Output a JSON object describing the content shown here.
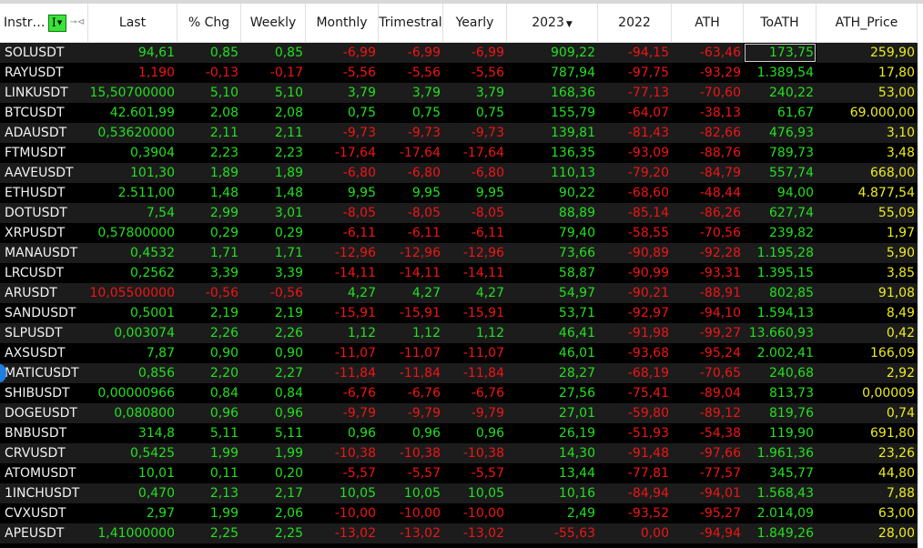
{
  "header": {
    "columns": [
      {
        "label": "Instr…",
        "key": "name"
      },
      {
        "label": "Last",
        "key": "last"
      },
      {
        "label": "% Chg",
        "key": "chg"
      },
      {
        "label": "Weekly",
        "key": "weekly"
      },
      {
        "label": "Monthly",
        "key": "monthly"
      },
      {
        "label": "Trimestral",
        "key": "trimestral"
      },
      {
        "label": "Yearly",
        "key": "yearly"
      },
      {
        "label": "2023",
        "key": "y2023",
        "sort": "descending"
      },
      {
        "label": "2022",
        "key": "y2022"
      },
      {
        "label": "ATH",
        "key": "ath"
      },
      {
        "label": "ToATH",
        "key": "toath"
      },
      {
        "label": "ATH_Price",
        "key": "ath_price"
      }
    ],
    "filter_button_label": "I",
    "filter_icon": "filter-dropdown-icon",
    "pin_icon": "pin-icon",
    "sort_icon": "sort-descending-icon"
  },
  "colors": {
    "positive": "#22e01e",
    "negative": "#f01414",
    "ath_price": "#ecec1e",
    "name": "#f2f2f2",
    "row_odd": "#1c1c1c",
    "row_even": "#000000",
    "filter_button": "#3ae23a"
  },
  "selected_cell": {
    "row": 0,
    "column": "toath"
  },
  "rows": [
    {
      "name": "SOLUSDT",
      "last": "94,61",
      "chg": "0,85",
      "weekly": "0,85",
      "monthly": "-6,99",
      "trimestral": "-6,99",
      "yearly": "-6,99",
      "y2023": "909,22",
      "y2022": "-94,15",
      "ath": "-63,46",
      "toath": "173,75",
      "ath_price": "259,90",
      "last_dir": "pos"
    },
    {
      "name": "RAYUSDT",
      "last": "1,190",
      "chg": "-0,13",
      "weekly": "-0,17",
      "monthly": "-5,56",
      "trimestral": "-5,56",
      "yearly": "-5,56",
      "y2023": "787,94",
      "y2022": "-97,75",
      "ath": "-93,29",
      "toath": "1.389,54",
      "ath_price": "17,80",
      "last_dir": "neg"
    },
    {
      "name": "LINKUSDT",
      "last": "15,50700000",
      "chg": "5,10",
      "weekly": "5,10",
      "monthly": "3,79",
      "trimestral": "3,79",
      "yearly": "3,79",
      "y2023": "168,36",
      "y2022": "-77,13",
      "ath": "-70,60",
      "toath": "240,22",
      "ath_price": "53,00",
      "last_dir": "pos"
    },
    {
      "name": "BTCUSDT",
      "last": "42.601,99",
      "chg": "2,08",
      "weekly": "2,08",
      "monthly": "0,75",
      "trimestral": "0,75",
      "yearly": "0,75",
      "y2023": "155,79",
      "y2022": "-64,07",
      "ath": "-38,13",
      "toath": "61,67",
      "ath_price": "69.000,00",
      "last_dir": "pos"
    },
    {
      "name": "ADAUSDT",
      "last": "0,53620000",
      "chg": "2,11",
      "weekly": "2,11",
      "monthly": "-9,73",
      "trimestral": "-9,73",
      "yearly": "-9,73",
      "y2023": "139,81",
      "y2022": "-81,43",
      "ath": "-82,66",
      "toath": "476,93",
      "ath_price": "3,10",
      "last_dir": "pos"
    },
    {
      "name": "FTMUSDT",
      "last": "0,3904",
      "chg": "2,23",
      "weekly": "2,23",
      "monthly": "-17,64",
      "trimestral": "-17,64",
      "yearly": "-17,64",
      "y2023": "136,35",
      "y2022": "-93,09",
      "ath": "-88,76",
      "toath": "789,73",
      "ath_price": "3,48",
      "last_dir": "pos"
    },
    {
      "name": "AAVEUSDT",
      "last": "101,30",
      "chg": "1,89",
      "weekly": "1,89",
      "monthly": "-6,80",
      "trimestral": "-6,80",
      "yearly": "-6,80",
      "y2023": "110,13",
      "y2022": "-79,20",
      "ath": "-84,79",
      "toath": "557,74",
      "ath_price": "668,00",
      "last_dir": "pos"
    },
    {
      "name": "ETHUSDT",
      "last": "2.511,00",
      "chg": "1,48",
      "weekly": "1,48",
      "monthly": "9,95",
      "trimestral": "9,95",
      "yearly": "9,95",
      "y2023": "90,22",
      "y2022": "-68,60",
      "ath": "-48,44",
      "toath": "94,00",
      "ath_price": "4.877,54",
      "last_dir": "pos"
    },
    {
      "name": "DOTUSDT",
      "last": "7,54",
      "chg": "2,99",
      "weekly": "3,01",
      "monthly": "-8,05",
      "trimestral": "-8,05",
      "yearly": "-8,05",
      "y2023": "88,89",
      "y2022": "-85,14",
      "ath": "-86,26",
      "toath": "627,74",
      "ath_price": "55,09",
      "last_dir": "pos"
    },
    {
      "name": "XRPUSDT",
      "last": "0,57800000",
      "chg": "0,29",
      "weekly": "0,29",
      "monthly": "-6,11",
      "trimestral": "-6,11",
      "yearly": "-6,11",
      "y2023": "79,40",
      "y2022": "-58,55",
      "ath": "-70,56",
      "toath": "239,82",
      "ath_price": "1,97",
      "last_dir": "pos"
    },
    {
      "name": "MANAUSDT",
      "last": "0,4532",
      "chg": "1,71",
      "weekly": "1,71",
      "monthly": "-12,96",
      "trimestral": "-12,96",
      "yearly": "-12,96",
      "y2023": "73,66",
      "y2022": "-90,89",
      "ath": "-92,28",
      "toath": "1.195,28",
      "ath_price": "5,90",
      "last_dir": "pos"
    },
    {
      "name": "LRCUSDT",
      "last": "0,2562",
      "chg": "3,39",
      "weekly": "3,39",
      "monthly": "-14,11",
      "trimestral": "-14,11",
      "yearly": "-14,11",
      "y2023": "58,87",
      "y2022": "-90,99",
      "ath": "-93,31",
      "toath": "1.395,15",
      "ath_price": "3,85",
      "last_dir": "pos"
    },
    {
      "name": "ARUSDT",
      "last": "10,05500000",
      "chg": "-0,56",
      "weekly": "-0,56",
      "monthly": "4,27",
      "trimestral": "4,27",
      "yearly": "4,27",
      "y2023": "54,97",
      "y2022": "-90,21",
      "ath": "-88,91",
      "toath": "802,85",
      "ath_price": "91,08",
      "last_dir": "neg"
    },
    {
      "name": "SANDUSDT",
      "last": "0,5001",
      "chg": "2,19",
      "weekly": "2,19",
      "monthly": "-15,91",
      "trimestral": "-15,91",
      "yearly": "-15,91",
      "y2023": "53,71",
      "y2022": "-92,97",
      "ath": "-94,10",
      "toath": "1.594,13",
      "ath_price": "8,49",
      "last_dir": "pos"
    },
    {
      "name": "SLPUSDT",
      "last": "0,003074",
      "chg": "2,26",
      "weekly": "2,26",
      "monthly": "1,12",
      "trimestral": "1,12",
      "yearly": "1,12",
      "y2023": "46,41",
      "y2022": "-91,98",
      "ath": "-99,27",
      "toath": "13.660,93",
      "ath_price": "0,42",
      "last_dir": "pos"
    },
    {
      "name": "AXSUSDT",
      "last": "7,87",
      "chg": "0,90",
      "weekly": "0,90",
      "monthly": "-11,07",
      "trimestral": "-11,07",
      "yearly": "-11,07",
      "y2023": "46,01",
      "y2022": "-93,68",
      "ath": "-95,24",
      "toath": "2.002,41",
      "ath_price": "166,09",
      "last_dir": "pos"
    },
    {
      "name": "MATICUSDT",
      "last": "0,856",
      "chg": "2,20",
      "weekly": "2,27",
      "monthly": "-11,84",
      "trimestral": "-11,84",
      "yearly": "-11,84",
      "y2023": "28,27",
      "y2022": "-68,19",
      "ath": "-70,65",
      "toath": "240,68",
      "ath_price": "2,92",
      "last_dir": "pos"
    },
    {
      "name": "SHIBUSDT",
      "last": "0,00000966",
      "chg": "0,84",
      "weekly": "0,84",
      "monthly": "-6,76",
      "trimestral": "-6,76",
      "yearly": "-6,76",
      "y2023": "27,56",
      "y2022": "-75,41",
      "ath": "-89,04",
      "toath": "813,73",
      "ath_price": "0,00009",
      "last_dir": "pos"
    },
    {
      "name": "DOGEUSDT",
      "last": "0,080800",
      "chg": "0,96",
      "weekly": "0,96",
      "monthly": "-9,79",
      "trimestral": "-9,79",
      "yearly": "-9,79",
      "y2023": "27,01",
      "y2022": "-59,80",
      "ath": "-89,12",
      "toath": "819,76",
      "ath_price": "0,74",
      "last_dir": "pos"
    },
    {
      "name": "BNBUSDT",
      "last": "314,8",
      "chg": "5,11",
      "weekly": "5,11",
      "monthly": "0,96",
      "trimestral": "0,96",
      "yearly": "0,96",
      "y2023": "26,19",
      "y2022": "-51,93",
      "ath": "-54,38",
      "toath": "119,90",
      "ath_price": "691,80",
      "last_dir": "pos"
    },
    {
      "name": "CRVUSDT",
      "last": "0,5425",
      "chg": "1,99",
      "weekly": "1,99",
      "monthly": "-10,38",
      "trimestral": "-10,38",
      "yearly": "-10,38",
      "y2023": "14,30",
      "y2022": "-91,48",
      "ath": "-97,66",
      "toath": "1.961,36",
      "ath_price": "23,26",
      "last_dir": "pos"
    },
    {
      "name": "ATOMUSDT",
      "last": "10,01",
      "chg": "0,11",
      "weekly": "0,20",
      "monthly": "-5,57",
      "trimestral": "-5,57",
      "yearly": "-5,57",
      "y2023": "13,44",
      "y2022": "-77,81",
      "ath": "-77,57",
      "toath": "345,77",
      "ath_price": "44,80",
      "last_dir": "pos"
    },
    {
      "name": "1INCHUSDT",
      "last": "0,470",
      "chg": "2,13",
      "weekly": "2,17",
      "monthly": "10,05",
      "trimestral": "10,05",
      "yearly": "10,05",
      "y2023": "10,16",
      "y2022": "-84,94",
      "ath": "-94,01",
      "toath": "1.568,43",
      "ath_price": "7,88",
      "last_dir": "pos"
    },
    {
      "name": "CVXUSDT",
      "last": "2,97",
      "chg": "1,99",
      "weekly": "2,06",
      "monthly": "-10,00",
      "trimestral": "-10,00",
      "yearly": "-10,00",
      "y2023": "2,49",
      "y2022": "-93,52",
      "ath": "-95,27",
      "toath": "2.014,09",
      "ath_price": "63,00",
      "last_dir": "pos"
    },
    {
      "name": "APEUSDT",
      "last": "1,41000000",
      "chg": "2,25",
      "weekly": "2,25",
      "monthly": "-13,02",
      "trimestral": "-13,02",
      "yearly": "-13,02",
      "y2023": "-55,63",
      "y2022": "0,00",
      "ath": "-94,94",
      "toath": "1.849,26",
      "ath_price": "28,00",
      "last_dir": "pos"
    }
  ]
}
